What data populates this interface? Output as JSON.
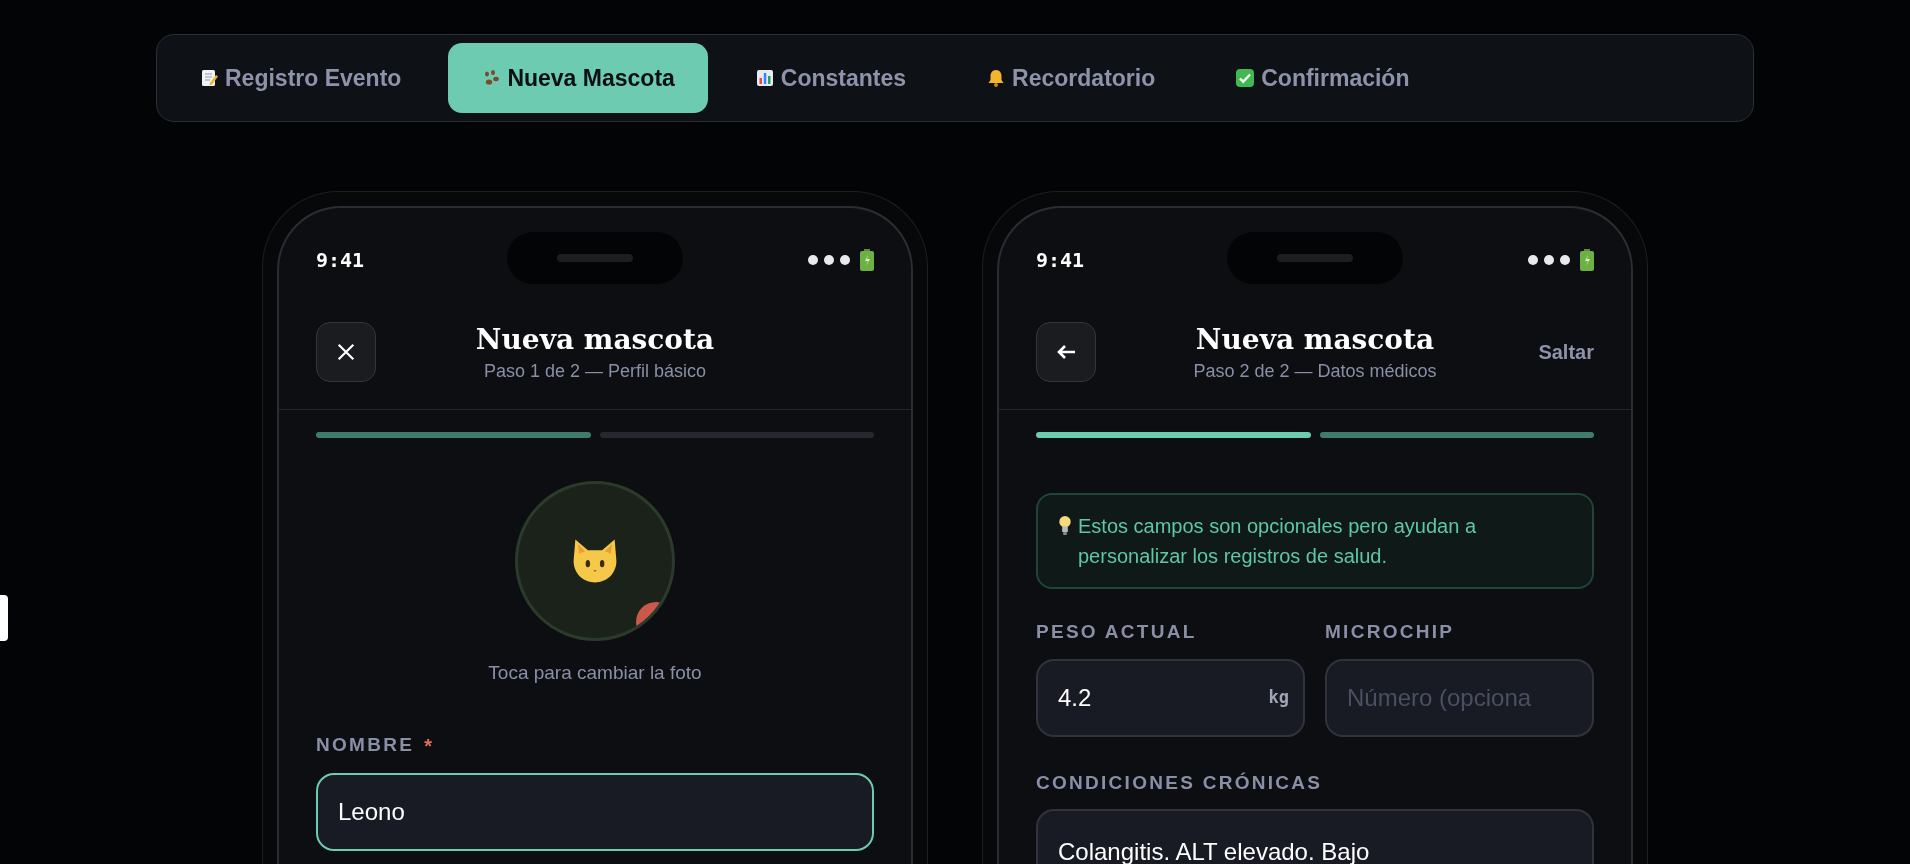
{
  "tabs": [
    {
      "label": "Registro Evento",
      "selected": false
    },
    {
      "label": "Nueva Mascota",
      "selected": true
    },
    {
      "label": "Constantes",
      "selected": false
    },
    {
      "label": "Recordatorio",
      "selected": false
    },
    {
      "label": "Confirmación",
      "selected": false
    }
  ],
  "phones": [
    {
      "status_bar": {
        "time": "9:41"
      },
      "header": {
        "back_button": false,
        "title": "Nueva mascota",
        "subtitle": "Paso 1 de 2 — Perfil básico"
      },
      "progress": [
        {
          "completed": false,
          "current": true
        },
        {
          "completed": false,
          "current": false
        }
      ],
      "content": [
        {
          "kind": "avatar",
          "caption": "Toca para cambiar la foto"
        },
        {
          "kind": "field",
          "label": "NOMBRE",
          "required_mark": "*",
          "value": "Leono",
          "focused": true
        }
      ]
    },
    {
      "status_bar": {
        "time": "9:41"
      },
      "header": {
        "back_button": true,
        "title": "Nueva mascota",
        "subtitle": "Paso 2 de 2 — Datos médicos",
        "action": "Saltar"
      },
      "progress": [
        {
          "completed": true,
          "current": false
        },
        {
          "completed": false,
          "current": true
        }
      ],
      "content": [
        {
          "kind": "hint",
          "text": "Estos campos son opcionales pero ayudan a personalizar los registros de salud."
        },
        {
          "kind": "field_row",
          "fields": [
            {
              "label": "PESO ACTUAL",
              "value": "4.2",
              "unit": "kg",
              "focused": false
            },
            {
              "label": "MICROCHIP",
              "placeholder": "Número (opciona",
              "focused": false
            }
          ]
        },
        {
          "kind": "textarea",
          "label": "CONDICIONES CRÓNICAS",
          "value": "Colangitis. ALT elevado. Bajo",
          "focused": false
        }
      ]
    }
  ]
}
